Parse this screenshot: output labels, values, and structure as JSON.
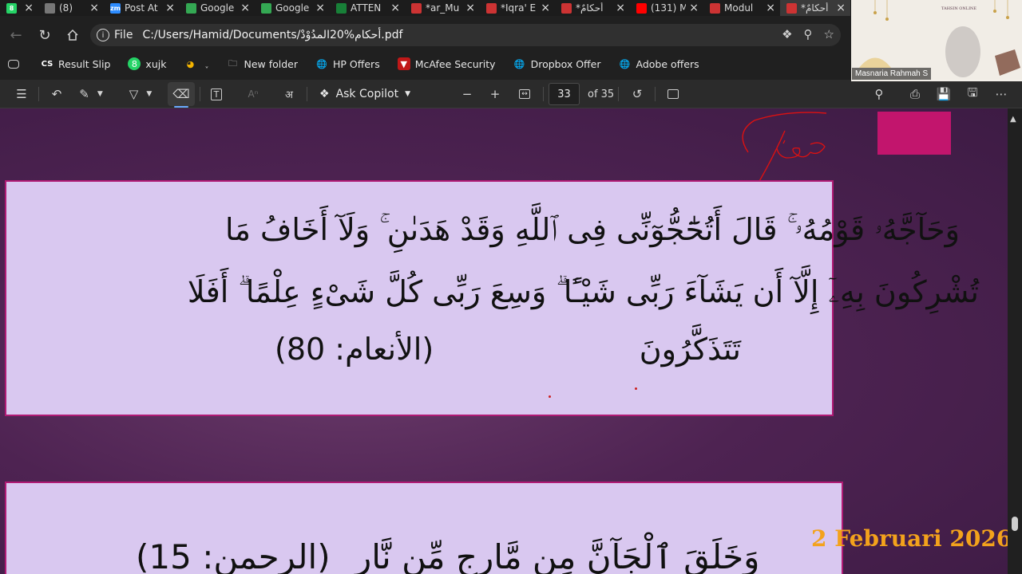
{
  "tabs": [
    {
      "label": "",
      "icon": "whatsapp-icon",
      "color": "#25d366",
      "badge": "8"
    },
    {
      "label": "(8)",
      "icon": "speaker-icon",
      "color": "#777777"
    },
    {
      "label": "Post At",
      "icon": "zoom-icon",
      "color": "#2d8cff",
      "badge": "zm"
    },
    {
      "label": "Google",
      "icon": "google-docs-icon",
      "color": "#34a853"
    },
    {
      "label": "Google",
      "icon": "google-docs-icon",
      "color": "#34a853"
    },
    {
      "label": "ATTEN",
      "icon": "sheets-icon",
      "color": "#188038"
    },
    {
      "label": "*ar_Mu",
      "icon": "pdf-icon",
      "color": "#c33"
    },
    {
      "label": "*Iqra' E",
      "icon": "pdf-icon",
      "color": "#c33"
    },
    {
      "label": "*أحكامٌ",
      "icon": "pdf-icon",
      "color": "#c33"
    },
    {
      "label": "(131) M",
      "icon": "youtube-icon",
      "color": "#ff0000"
    },
    {
      "label": "Modul",
      "icon": "pdf-icon",
      "color": "#c33"
    },
    {
      "label": "*أحكامٌ",
      "icon": "pdf-icon",
      "color": "#c33",
      "active": true
    }
  ],
  "address": {
    "scheme": "File",
    "url": "C:/Users/Hamid/Documents/أحكام%20المدُوْدْ.pdf"
  },
  "bookmarks": [
    {
      "label": "Result Slip",
      "icon": "cs-icon"
    },
    {
      "label": "xujk",
      "icon": "whatsapp-icon"
    },
    {
      "label": "",
      "icon": "colorful-icon",
      "caret": true
    },
    {
      "label": "New folder",
      "icon": "folder-icon"
    },
    {
      "label": "HP Offers",
      "icon": "globe-icon"
    },
    {
      "label": "McAfee Security",
      "icon": "mcafee-icon"
    },
    {
      "label": "Dropbox Offer",
      "icon": "globe-icon"
    },
    {
      "label": "Adobe offers",
      "icon": "globe-icon"
    }
  ],
  "pdf_toolbar": {
    "copilot_label": "Ask Copilot",
    "page_current": "33",
    "page_total": "of 35"
  },
  "video": {
    "participant_name": "Masnaria Rahmah S",
    "banner_text": "TAHSIN ONLINE"
  },
  "slide": {
    "line1": "وَحَآجَّهُۥ قَوْمُهُۥ ۚ قَالَ أَتُحَٰٓجُّوٓنِّى فِى ٱللَّهِ وَقَدْ هَدَىٰنِ ۚ وَلَآ أَخَافُ مَا",
    "line2": "تُشْرِكُونَ بِهِۦٓ إِلَّآ أَن يَشَآءَ رَبِّى شَيْـًٔا ۗ وَسِعَ رَبِّى كُلَّ شَىْءٍ عِلْمًا ۗ أَفَلَا",
    "line3": "تَتَذَكَّرُونَ",
    "ref1": "(الأنعام: 80)",
    "line4": "وَخَلَقَ ٱلْجَآنَّ مِن مَّارِجٍ مِّن نَّارٍ",
    "ref2": "(الرحمن: 15)",
    "annotation": "حاجة",
    "date": "2 Februari 2026"
  }
}
